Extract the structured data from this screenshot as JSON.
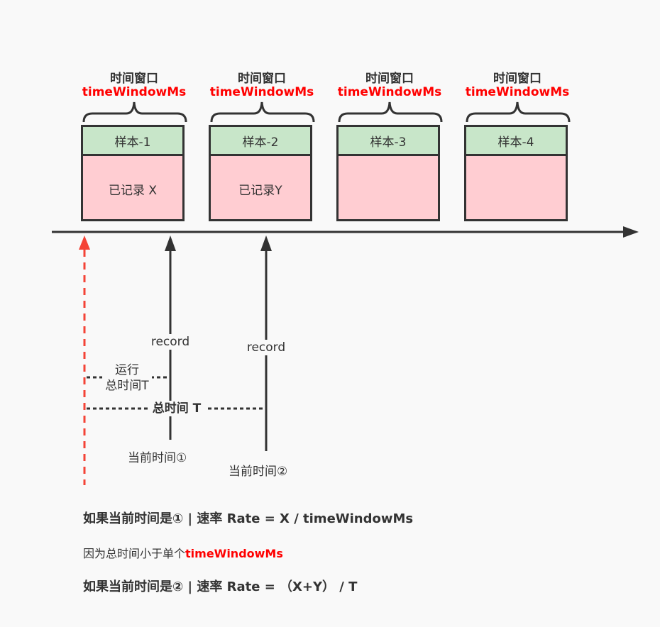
{
  "windows": [
    {
      "title": "时间窗口",
      "subtitle": "timeWindowMs",
      "sample": "样本-1",
      "recorded": "已记录 X"
    },
    {
      "title": "时间窗口",
      "subtitle": "timeWindowMs",
      "sample": "样本-2",
      "recorded": "已记录Y"
    },
    {
      "title": "时间窗口",
      "subtitle": "timeWindowMs",
      "sample": "样本-3",
      "recorded": ""
    },
    {
      "title": "时间窗口",
      "subtitle": "timeWindowMs",
      "sample": "样本-4",
      "recorded": ""
    }
  ],
  "arrows": {
    "record_1": "record",
    "record_2": "record",
    "current_time_1": "当前时间①",
    "current_time_2": "当前时间②"
  },
  "spans": {
    "run_total_line1": "运行",
    "run_total_line2": "总时间T",
    "total_time": "总时间 T"
  },
  "notes": {
    "case1": "如果当前时间是① | 速率 Rate = X / timeWindowMs",
    "reason_prefix": "因为总时间小于单个",
    "reason_highlight": "timeWindowMs",
    "case2": "如果当前时间是② | 速率 Rate = （X+Y） / T"
  },
  "colors": {
    "sample_header": "#c8e6c9",
    "sample_body": "#ffcdd2",
    "accent_red": "#ff0000",
    "start_marker": "#f44336",
    "line": "#333333"
  }
}
